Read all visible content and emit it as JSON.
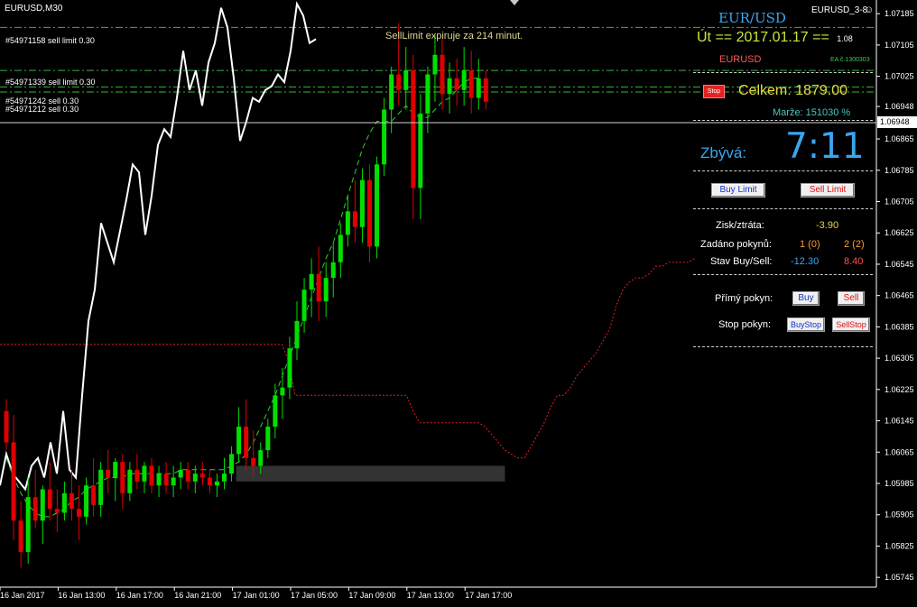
{
  "window": {
    "symbol_label": "EURUSD,M30",
    "ea_name": "EURUSD_3-8",
    "smiley": "☺"
  },
  "orders": [
    {
      "text": "#54971158 sell limit 0.30",
      "price": 1.0715
    },
    {
      "text": "#54971339 sell limit 0.30",
      "price": 1.0704
    },
    {
      "text": "#54971242 sell 0.30",
      "price": 1.06998
    },
    {
      "text": "#54971212 sell 0.30",
      "price": 1.06985
    }
  ],
  "chart_overlay": {
    "expiry_text": "SellLimit expiruje za 214 minut."
  },
  "panel": {
    "pair": "EUR/USD",
    "day_prefix": "Út  ==",
    "date": "2017.01.17",
    "day_suffix": "==",
    "day_small": "1.08",
    "symbol": "EURUSD",
    "ea_code": "EA č.1300303",
    "stop_label": "Stop",
    "celkem": "Celkem: 1879.00",
    "marze": "Marže: 151030 %",
    "zbyva_label": "Zbývá:",
    "time_left": "7:11",
    "buy_limit_label": "Buy Limit",
    "sell_limit_label": "Sell Limit",
    "zisk_label": "Zisk/ztráta:",
    "zisk_value": "-3.90",
    "zadano_label": "Zadáno pokynů:",
    "zadano_buy": "1 (0)",
    "zadano_sell": "2 (2)",
    "stav_label": "Stav Buy/Sell:",
    "stav_buy": "-12.30",
    "stav_sell": "8.40",
    "primy_label": "Přímý pokyn:",
    "buy_label": "Buy",
    "sell_label": "Sell",
    "stop_pokyn_label": "Stop pokyn:",
    "buystop_label": "BuyStop",
    "sellstop_label": "SellStop"
  },
  "colors": {
    "bull": "#00e000",
    "bear": "#e00000",
    "white_line": "#ffffff",
    "red_dotted": "#e02020",
    "accent_blue": "#3aa6ef"
  },
  "chart_data": {
    "type": "candlestick",
    "current_price": "1.06948",
    "ylim": [
      1.0572,
      1.0722
    ],
    "y_ticks": [
      "1.07185",
      "1.07105",
      "1.07025",
      "1.06948",
      "1.06865",
      "1.06785",
      "1.06705",
      "1.06625",
      "1.06545",
      "1.06465",
      "1.06385",
      "1.06305",
      "1.06225",
      "1.06145",
      "1.06065",
      "1.05985",
      "1.05905",
      "1.05825",
      "1.05745"
    ],
    "x_ticks": [
      {
        "label": "16 Jan 2017",
        "bar": 0
      },
      {
        "label": "16 Jan 13:00",
        "bar": 8
      },
      {
        "label": "16 Jan 17:00",
        "bar": 16
      },
      {
        "label": "16 Jan 21:00",
        "bar": 24
      },
      {
        "label": "17 Jan 01:00",
        "bar": 32
      },
      {
        "label": "17 Jan 05:00",
        "bar": 40
      },
      {
        "label": "17 Jan 09:00",
        "bar": 48
      },
      {
        "label": "17 Jan 13:00",
        "bar": 56
      },
      {
        "label": "17 Jan 17:00",
        "bar": 64
      }
    ],
    "candles": [
      [
        1.0617,
        1.062,
        1.0607,
        1.0609
      ],
      [
        1.0609,
        1.0616,
        1.0584,
        1.0589
      ],
      [
        1.0589,
        1.0594,
        1.0577,
        1.0581
      ],
      [
        1.0581,
        1.06,
        1.0578,
        1.0595
      ],
      [
        1.0595,
        1.0602,
        1.0587,
        1.0589
      ],
      [
        1.0589,
        1.0598,
        1.0583,
        1.0597
      ],
      [
        1.0597,
        1.0604,
        1.0589,
        1.0592
      ],
      [
        1.0592,
        1.0597,
        1.0586,
        1.0591
      ],
      [
        1.0591,
        1.0599,
        1.0589,
        1.0596
      ],
      [
        1.0596,
        1.0602,
        1.0589,
        1.0592
      ],
      [
        1.0592,
        1.0598,
        1.0584,
        1.059
      ],
      [
        1.059,
        1.06,
        1.0588,
        1.0598
      ],
      [
        1.0598,
        1.0605,
        1.059,
        1.0593
      ],
      [
        1.0593,
        1.0604,
        1.059,
        1.0602
      ],
      [
        1.0602,
        1.0607,
        1.0596,
        1.06
      ],
      [
        1.06,
        1.0605,
        1.0594,
        1.0604
      ],
      [
        1.0604,
        1.0606,
        1.0592,
        1.0596
      ],
      [
        1.0596,
        1.0604,
        1.0594,
        1.0602
      ],
      [
        1.0602,
        1.0606,
        1.0597,
        1.0599
      ],
      [
        1.0599,
        1.0604,
        1.0596,
        1.0603
      ],
      [
        1.0603,
        1.0605,
        1.0596,
        1.0598
      ],
      [
        1.0598,
        1.0603,
        1.0595,
        1.0601
      ],
      [
        1.0601,
        1.0604,
        1.0596,
        1.0598
      ],
      [
        1.0598,
        1.0603,
        1.0595,
        1.06
      ],
      [
        1.06,
        1.0604,
        1.0597,
        1.0602
      ],
      [
        1.0602,
        1.0604,
        1.0597,
        1.0599
      ],
      [
        1.0599,
        1.0603,
        1.0596,
        1.0601
      ],
      [
        1.0601,
        1.0604,
        1.0598,
        1.06
      ],
      [
        1.06,
        1.0602,
        1.0596,
        1.0598
      ],
      [
        1.0598,
        1.0601,
        1.0595,
        1.0599
      ],
      [
        1.0599,
        1.0605,
        1.0597,
        1.0601
      ],
      [
        1.0601,
        1.0608,
        1.0599,
        1.0606
      ],
      [
        1.0606,
        1.0618,
        1.0604,
        1.0613
      ],
      [
        1.0613,
        1.062,
        1.0602,
        1.0605
      ],
      [
        1.0605,
        1.0612,
        1.06,
        1.0603
      ],
      [
        1.0603,
        1.0609,
        1.0601,
        1.0607
      ],
      [
        1.0607,
        1.0615,
        1.0605,
        1.0613
      ],
      [
        1.0613,
        1.0624,
        1.061,
        1.0621
      ],
      [
        1.0621,
        1.0628,
        1.0615,
        1.0623
      ],
      [
        1.0623,
        1.0636,
        1.062,
        1.0633
      ],
      [
        1.0633,
        1.0645,
        1.063,
        1.064
      ],
      [
        1.064,
        1.0651,
        1.0637,
        1.0648
      ],
      [
        1.0648,
        1.0656,
        1.0641,
        1.0652
      ],
      [
        1.0652,
        1.0659,
        1.064,
        1.0645
      ],
      [
        1.0645,
        1.0655,
        1.0641,
        1.0651
      ],
      [
        1.0651,
        1.066,
        1.0646,
        1.0655
      ],
      [
        1.0655,
        1.0665,
        1.0651,
        1.0662
      ],
      [
        1.0662,
        1.0672,
        1.0659,
        1.0668
      ],
      [
        1.0668,
        1.0676,
        1.066,
        1.0664
      ],
      [
        1.0664,
        1.0679,
        1.066,
        1.0676
      ],
      [
        1.0676,
        1.068,
        1.0655,
        1.0659
      ],
      [
        1.0659,
        1.0682,
        1.0656,
        1.068
      ],
      [
        1.068,
        1.0697,
        1.0677,
        1.0694
      ],
      [
        1.0694,
        1.0705,
        1.0688,
        1.0703
      ],
      [
        1.0703,
        1.0716,
        1.0695,
        1.0699
      ],
      [
        1.0699,
        1.071,
        1.0694,
        1.0704
      ],
      [
        1.0704,
        1.0708,
        1.0666,
        1.0674
      ],
      [
        1.0674,
        1.0698,
        1.0666,
        1.0693
      ],
      [
        1.0693,
        1.0705,
        1.0688,
        1.0703
      ],
      [
        1.0703,
        1.0713,
        1.0696,
        1.0708
      ],
      [
        1.0708,
        1.0712,
        1.0694,
        1.0698
      ],
      [
        1.0698,
        1.0706,
        1.0693,
        1.0702
      ],
      [
        1.0702,
        1.0707,
        1.0695,
        1.0699
      ],
      [
        1.0699,
        1.071,
        1.0695,
        1.0704
      ],
      [
        1.0704,
        1.0709,
        1.0693,
        1.0697
      ],
      [
        1.0697,
        1.0707,
        1.0694,
        1.0702
      ],
      [
        1.0702,
        1.0704,
        1.0694,
        1.0696
      ]
    ],
    "white_series": [
      1.0598,
      1.0606,
      1.0601,
      1.0599,
      1.0597,
      1.0603,
      1.0605,
      1.06,
      1.0609,
      1.0601,
      1.0617,
      1.0602,
      1.06,
      1.0621,
      1.064,
      1.0648,
      1.0665,
      1.066,
      1.0655,
      1.0663,
      1.0671,
      1.068,
      1.0678,
      1.0662,
      1.0672,
      1.0685,
      1.0689,
      1.0687,
      1.0697,
      1.0709,
      1.0699,
      1.0704,
      1.0695,
      1.0706,
      1.0711,
      1.072,
      1.0715,
      1.0702,
      1.0686,
      1.0691,
      1.0697,
      1.0696,
      1.0699,
      1.07,
      1.0703,
      1.0701,
      1.0709,
      1.0721,
      1.0718,
      1.0711,
      1.0712
    ],
    "red_dotted": [
      1.0634,
      1.0634,
      1.0634,
      1.0634,
      1.0634,
      1.0634,
      1.0634,
      1.0634,
      1.0634,
      1.0634,
      1.0634,
      1.0634,
      1.0634,
      1.0634,
      1.0634,
      1.0634,
      1.0634,
      1.0634,
      1.0634,
      1.0634,
      1.0634,
      1.0634,
      1.0634,
      1.0634,
      1.0634,
      1.0634,
      1.0634,
      1.0634,
      1.0634,
      1.0634,
      1.0634,
      1.0634,
      1.0634,
      1.0634,
      1.0634,
      1.0634,
      1.0634,
      1.0634,
      1.0634,
      1.0634,
      1.0634,
      1.0634,
      1.0634,
      1.0634,
      1.063,
      1.0621,
      1.0621,
      1.0621,
      1.0621,
      1.0621,
      1.0621,
      1.0621,
      1.0621,
      1.0621,
      1.0621,
      1.0621,
      1.0621,
      1.0621,
      1.0621,
      1.0621,
      1.0621,
      1.0621,
      1.0621,
      1.0617,
      1.0614,
      1.0614,
      1.0614,
      1.0614,
      1.0614,
      1.0614,
      1.0614,
      1.0614,
      1.0614,
      1.0614,
      1.0613,
      1.0611,
      1.0609,
      1.0607,
      1.0606,
      1.0605,
      1.0605,
      1.0608,
      1.0611,
      1.0614,
      1.0618,
      1.0621,
      1.0621,
      1.0623,
      1.0626,
      1.0628,
      1.063,
      1.0632,
      1.0635,
      1.0638,
      1.0644,
      1.0648,
      1.065,
      1.0651,
      1.0651,
      1.0652,
      1.0654,
      1.0654,
      1.0655,
      1.0655,
      1.0655,
      1.0655,
      1.0656
    ],
    "green_dashed": [
      1.0605,
      1.06,
      1.0596,
      1.0593,
      1.0591,
      1.059,
      1.059,
      1.0591,
      1.0592,
      1.0594,
      1.0595,
      1.0597,
      1.0598,
      1.0599,
      1.06,
      1.06,
      1.06,
      1.0601,
      1.0601,
      1.0601,
      1.0601,
      1.0601,
      1.0601,
      1.0601,
      1.0602,
      1.0602,
      1.0602,
      1.0602,
      1.0602,
      1.0602,
      1.0602,
      1.0603,
      1.0604,
      1.0606,
      1.0609,
      1.0613,
      1.0617,
      1.0621,
      1.0626,
      1.0631,
      1.0636,
      1.0641,
      1.0646,
      1.0651,
      1.0656,
      1.066,
      1.0666,
      1.0672,
      1.0678,
      1.0684,
      1.0688,
      1.0691,
      1.0691,
      1.0691,
      1.0693,
      1.0695,
      1.0693,
      1.0692,
      1.0692,
      1.0694,
      1.0696,
      1.0697,
      1.0699,
      1.0701,
      1.0702,
      1.0702
    ],
    "grey_zone": [
      1.0603,
      1.0599
    ]
  }
}
